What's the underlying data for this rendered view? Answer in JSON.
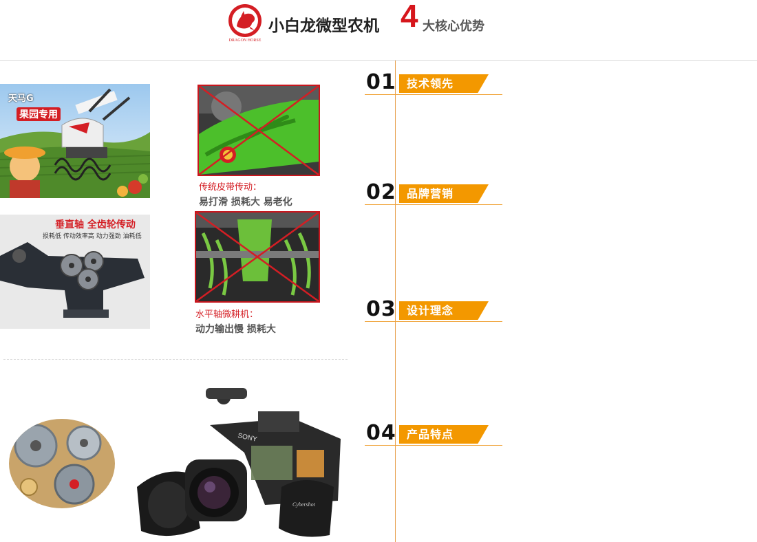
{
  "header": {
    "logo_text": "DRAGON HORSE",
    "title_main": "小白龙微型农机",
    "title_number": "4",
    "title_sub": "大核心优势"
  },
  "panels": {
    "tianma": {
      "tag_line1": "天马G",
      "tag_line2": "果园专用"
    },
    "belt": {
      "caption_red": "传统皮带传动：",
      "caption_gray": "易打滑 损耗大 易老化"
    },
    "gear": {
      "headline": "垂直轴 全齿轮传动",
      "subline": "损耗低 传动效率高 动力强劲 油耗低"
    },
    "horizontal": {
      "caption_red": "水平轴微耕机：",
      "caption_gray": "动力输出慢 损耗大"
    },
    "camera": {
      "brand": "SONY",
      "model": "Cybershot"
    }
  },
  "features": [
    {
      "number": "01",
      "label": "技术领先"
    },
    {
      "number": "02",
      "label": "品牌营销"
    },
    {
      "number": "03",
      "label": "设计理念"
    },
    {
      "number": "04",
      "label": "产品特点"
    }
  ],
  "colors": {
    "accent_orange": "#f39800",
    "accent_red": "#d41e24",
    "column_line": "#e7a14f"
  }
}
